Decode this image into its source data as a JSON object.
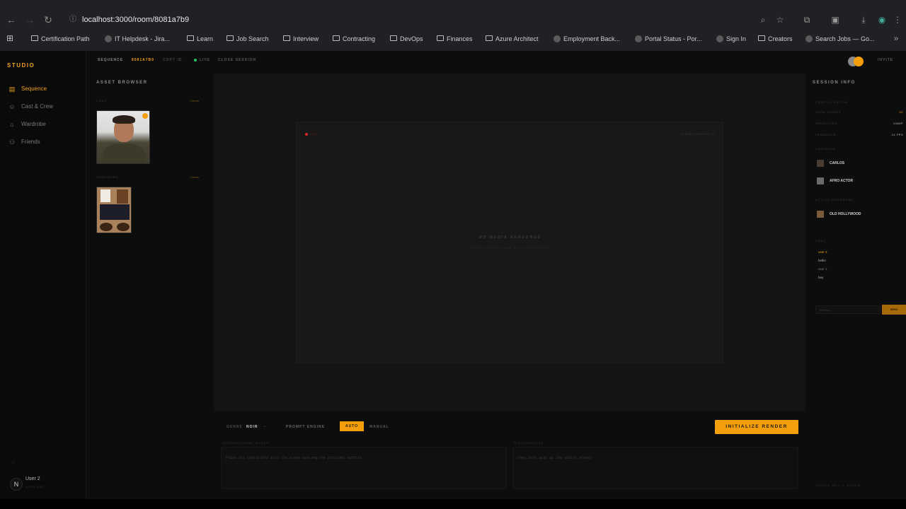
{
  "browser": {
    "url": "localhost:3000/room/8081a7b9",
    "bookmarks": [
      {
        "label": "Certification Path",
        "kind": "folder"
      },
      {
        "label": "IT Helpdesk - Jira...",
        "kind": "site"
      },
      {
        "label": "Learn",
        "kind": "folder"
      },
      {
        "label": "Job Search",
        "kind": "folder"
      },
      {
        "label": "Interview",
        "kind": "folder"
      },
      {
        "label": "Contracting",
        "kind": "folder"
      },
      {
        "label": "DevOps",
        "kind": "folder"
      },
      {
        "label": "Finances",
        "kind": "folder"
      },
      {
        "label": "Azure Architect",
        "kind": "folder"
      },
      {
        "label": "Employment Back...",
        "kind": "site"
      },
      {
        "label": "Portal Status - Por...",
        "kind": "site"
      },
      {
        "label": "Sign In",
        "kind": "site"
      },
      {
        "label": "Creators",
        "kind": "folder"
      },
      {
        "label": "Search Jobs — Go...",
        "kind": "site"
      }
    ]
  },
  "sidebar": {
    "brand": "STUDIO",
    "items": [
      {
        "label": "Sequence",
        "icon": "sequence-icon",
        "active": true
      },
      {
        "label": "Cast & Crew",
        "icon": "users-icon",
        "active": false
      },
      {
        "label": "Wardrobe",
        "icon": "hanger-icon",
        "active": false
      },
      {
        "label": "Friends",
        "icon": "friends-icon",
        "active": false
      }
    ],
    "user": {
      "name": "User 2",
      "avatar_letter": "N",
      "signout": "SIGN OUT"
    }
  },
  "topbar": {
    "sequence_label": "SEQUENCE",
    "sequence_id": "8081a7b9",
    "copy": "COPY ID",
    "live": "LIVE",
    "close": "CLOSE SESSION",
    "invite": "INVITE"
  },
  "assets": {
    "title": "ASSET BROWSER",
    "cast_label": "CAST",
    "cast_count": "1 items",
    "wardrobe_label": "WARDROBE",
    "wardrobe_count": "1 items"
  },
  "stage": {
    "rec": "REC",
    "preview_tag": "SCENE_PREVIEW_V1",
    "empty_title": "NO MEDIA RENDERED",
    "empty_sub": "SELECT ASSETS AND CLICK RE-RENDER"
  },
  "session": {
    "title": "SESSION INFO",
    "configuration": "CONFIGURATION",
    "rows": [
      {
        "k": "TOTAL SCENES",
        "v": "02"
      },
      {
        "k": "RESOLUTION",
        "v": "1080P"
      },
      {
        "k": "FRAMERATE",
        "v": "24 FPS"
      }
    ],
    "assigned_label": "ASSIGNED",
    "actors": [
      "CARLOS",
      "AFRO ACTOR"
    ],
    "wardrobe_label": "ACTIVE WARDROBE",
    "wardrobe": [
      "OLD HOLLYWOOD"
    ],
    "chat_label": "CHAT",
    "chat": [
      "user 2",
      "hello!",
      "user 1",
      "hey"
    ],
    "chat_placeholder": "Message...",
    "send": "SEND"
  },
  "controls": {
    "genre_label": "GENRE",
    "genre_value": "NOIR",
    "engine_label": "PROMPT ENGINE",
    "engine_auto": "AUTO",
    "engine_manual": "MANUAL",
    "render": "INITIALIZE RENDER",
    "instructions_label": "INSTRUCTIONAL NOTES",
    "instructions_text": "Place all characters into the scene wearing the provided outfits",
    "dialogue_label": "DIALOGUE/CUE",
    "dialogue_text": "they both walk up the stairs slowly",
    "footer": "STUDIO V0.1 — CLOUD"
  },
  "colors": {
    "accent": "#f59e0b",
    "bg": "#0d0d0d",
    "live": "#22c55e",
    "rec": "#dc2626"
  }
}
